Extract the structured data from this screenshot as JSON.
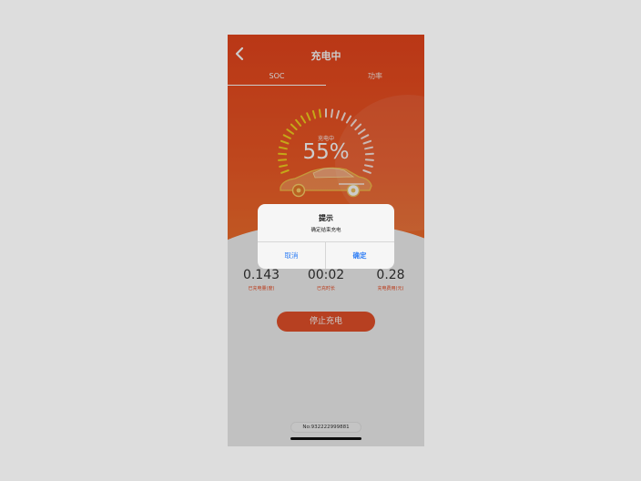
{
  "page": {
    "background": "#dddddd",
    "accent": "#e8451c",
    "link_color": "#2f7ef5"
  },
  "navbar": {
    "back_icon": "chevron-left-icon",
    "title": "充电中"
  },
  "tabs": [
    {
      "label": "SOC",
      "active": true
    },
    {
      "label": "功率",
      "active": false
    }
  ],
  "gauge": {
    "label": "充电中",
    "value": "55%",
    "level": 0.55,
    "ticks_total": 29,
    "ticks_lit": 14
  },
  "stats": [
    {
      "value": "0.143",
      "label": "已充电量(度)"
    },
    {
      "value": "00:02",
      "label": "已充时长"
    },
    {
      "value": "0.28",
      "label": "充电费用(元)"
    }
  ],
  "stop_button": {
    "label": "停止充电"
  },
  "order": {
    "number": "No:932222999881"
  },
  "dialog": {
    "title": "提示",
    "message": "确定结束充电",
    "cancel_label": "取消",
    "confirm_label": "确定"
  }
}
